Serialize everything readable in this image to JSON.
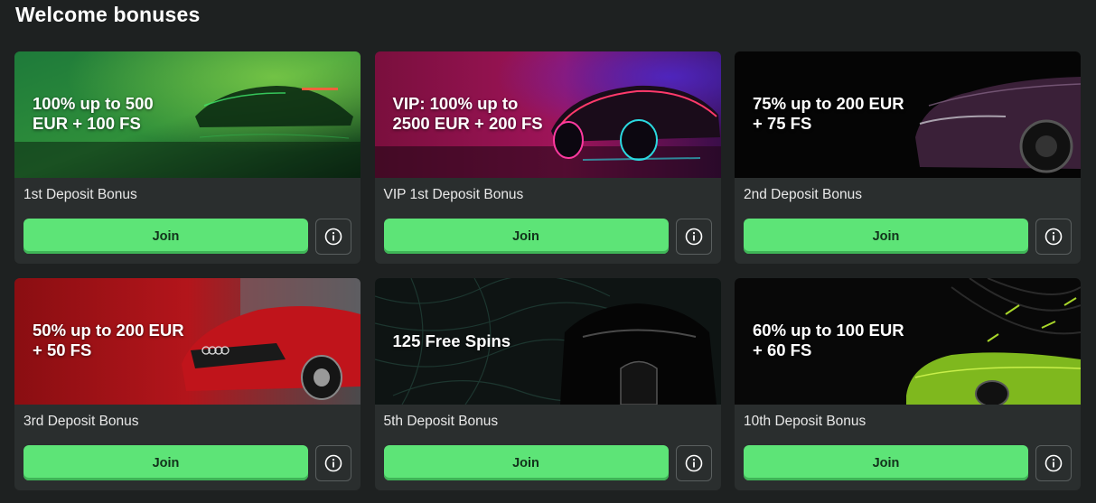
{
  "page": {
    "title": "Welcome bonuses"
  },
  "colors": {
    "background": "#1e2121",
    "card": "#2a2e2e",
    "accent": "#5de477",
    "join_text": "#12321b"
  },
  "icons": {
    "info": "info-circle-icon"
  },
  "bonuses": [
    {
      "headline": [
        "100% up to 500",
        "EUR + 100 FS"
      ],
      "name": "1st Deposit Bonus",
      "join_label": "Join",
      "theme": "green-supercar"
    },
    {
      "headline": [
        "VIP: 100% up to",
        "2500 EUR + 200 FS"
      ],
      "name": "VIP 1st Deposit Bonus",
      "join_label": "Join",
      "theme": "neon-supercar"
    },
    {
      "headline": [
        "75% up to 200 EUR",
        "+ 75 FS"
      ],
      "name": "2nd Deposit Bonus",
      "join_label": "Join",
      "theme": "dark-purple-car"
    },
    {
      "headline": [
        "50% up to 200 EUR",
        "+ 50 FS"
      ],
      "name": "3rd Deposit Bonus",
      "join_label": "Join",
      "theme": "red-sedan"
    },
    {
      "headline": [
        "125 Free Spins"
      ],
      "name": "5th Deposit Bonus",
      "join_label": "Join",
      "theme": "black-hypercar"
    },
    {
      "headline": [
        "60% up to 100 EUR",
        "+ 60 FS"
      ],
      "name": "10th Deposit Bonus",
      "join_label": "Join",
      "theme": "lime-supercar"
    }
  ]
}
